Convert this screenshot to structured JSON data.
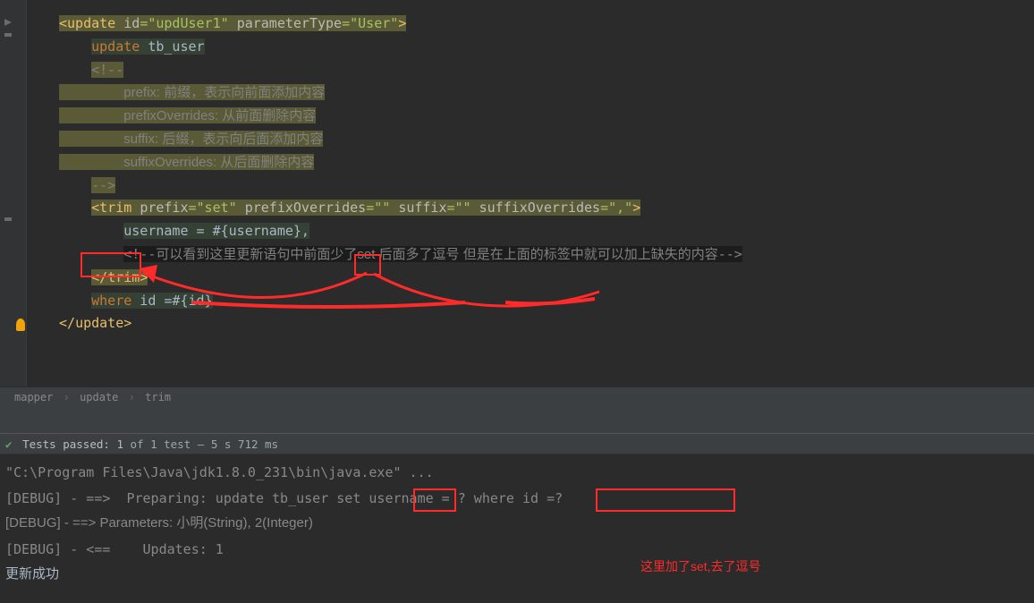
{
  "code": {
    "tag_update_open": "<update",
    "attr_id": "id",
    "val_id": "\"updUser1\"",
    "attr_pt": "parameterType",
    "val_pt": "\"User\"",
    "gt": ">",
    "update_kw": "update",
    "tb_user": " tb_user",
    "cmt_open": "<!--",
    "cmt_l1": "prefix: 前缀，表示向前面添加内容",
    "cmt_l2": "prefixOverrides: 从前面删除内容",
    "cmt_l3": "suffix: 后缀，表示向后面添加内容",
    "cmt_l4": "suffixOverrides: 从后面删除内容",
    "cmt_close": "-->",
    "tag_trim_open": "<trim",
    "attr_prefix": "prefix",
    "val_prefix": "\"set\"",
    "attr_po": "prefixOverrides",
    "val_empty1": "\"\"",
    "attr_suffix": "suffix",
    "val_empty2": "\"\"",
    "attr_so": "suffixOverrides",
    "val_so": "\",\"",
    "username_line": "username = #{username},",
    "cmt_inline_open": "<!--",
    "cmt_inline_txt": "可以看到这里更新语句中前面少了set 后面多了逗号 但是在上面的标签中就可以加上缺失的内容",
    "cmt_inline_close": "-->",
    "tag_trim_close": "</",
    "trim_name": "trim",
    "where_line_a": "where",
    "where_line_b": " id =#{id}",
    "tag_update_close": "</",
    "update_name": "update"
  },
  "breadcrumb": {
    "items": [
      "mapper",
      "update",
      "trim"
    ]
  },
  "tests": {
    "passed_label": "Tests passed:",
    "passed_count": "1",
    "of": "of 1 test",
    "time": "– 5 s 712 ms"
  },
  "console": {
    "l1": "\"C:\\Program Files\\Java\\jdk1.8.0_231\\bin\\java.exe\" ...",
    "l2a": "[DEBUG] - ==>  Preparing: update tb_user ",
    "l2b": "set",
    "l2c": " username = ? ",
    "l2d": "where id =?",
    "l3": "[DEBUG] - ==> Parameters: 小明(String), 2(Integer)",
    "l4": "[DEBUG] - <==    Updates: 1",
    "l5": "更新成功"
  },
  "annotation": {
    "note": "这里加了set,去了逗号"
  }
}
